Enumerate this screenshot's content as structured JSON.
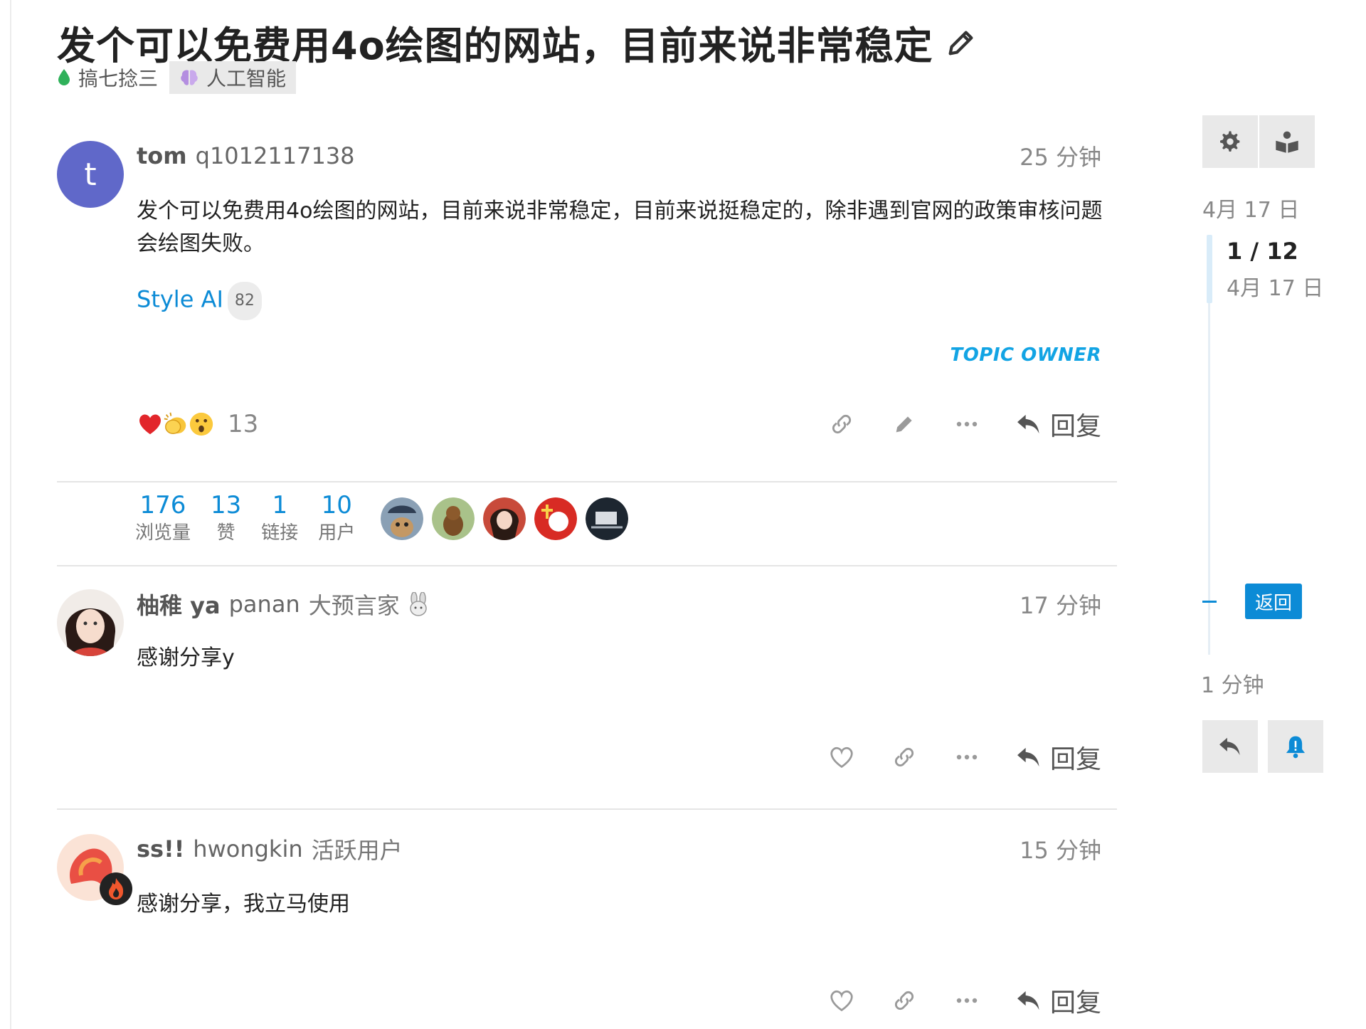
{
  "topic": {
    "title": "发个可以免费用4o绘图的网站，目前来说非常稳定",
    "category": "搞七捻三",
    "tag": "人工智能"
  },
  "posts": [
    {
      "username": "tom",
      "fullname": "q1012117138",
      "user_title": "",
      "time": "25 分钟",
      "avatar_letter": "t",
      "body": "发个可以免费用4o绘图的网站，目前来说非常稳定，目前来说挺稳定的，除非遇到官网的政策审核问题会绘图失败。",
      "link_text": "Style AI",
      "link_clicks": "82",
      "owner_label": "TOPIC OWNER",
      "reaction_count": "13",
      "reply_label": "回复"
    },
    {
      "username": "柚稚 ya",
      "fullname": "panan",
      "user_title": "大预言家",
      "time": "17 分钟",
      "body": "感谢分享y",
      "reply_label": "回复"
    },
    {
      "username": "ss!!",
      "fullname": "hwongkin",
      "user_title": "活跃用户",
      "time": "15 分钟",
      "body": "感谢分享，我立马使用",
      "reply_label": "回复"
    }
  ],
  "stats": [
    {
      "value": "176",
      "label": "浏览量"
    },
    {
      "value": "13",
      "label": "赞"
    },
    {
      "value": "1",
      "label": "链接"
    },
    {
      "value": "10",
      "label": "用户"
    }
  ],
  "timeline": {
    "start_date": "4月 17 日",
    "position": "1 / 12",
    "position_date": "4月 17 日",
    "back_label": "返回",
    "end_date": "1 分钟"
  },
  "colors": {
    "accent": "#0c8bd6",
    "owner": "#12a4e4",
    "avatar_t": "#6068c9"
  }
}
